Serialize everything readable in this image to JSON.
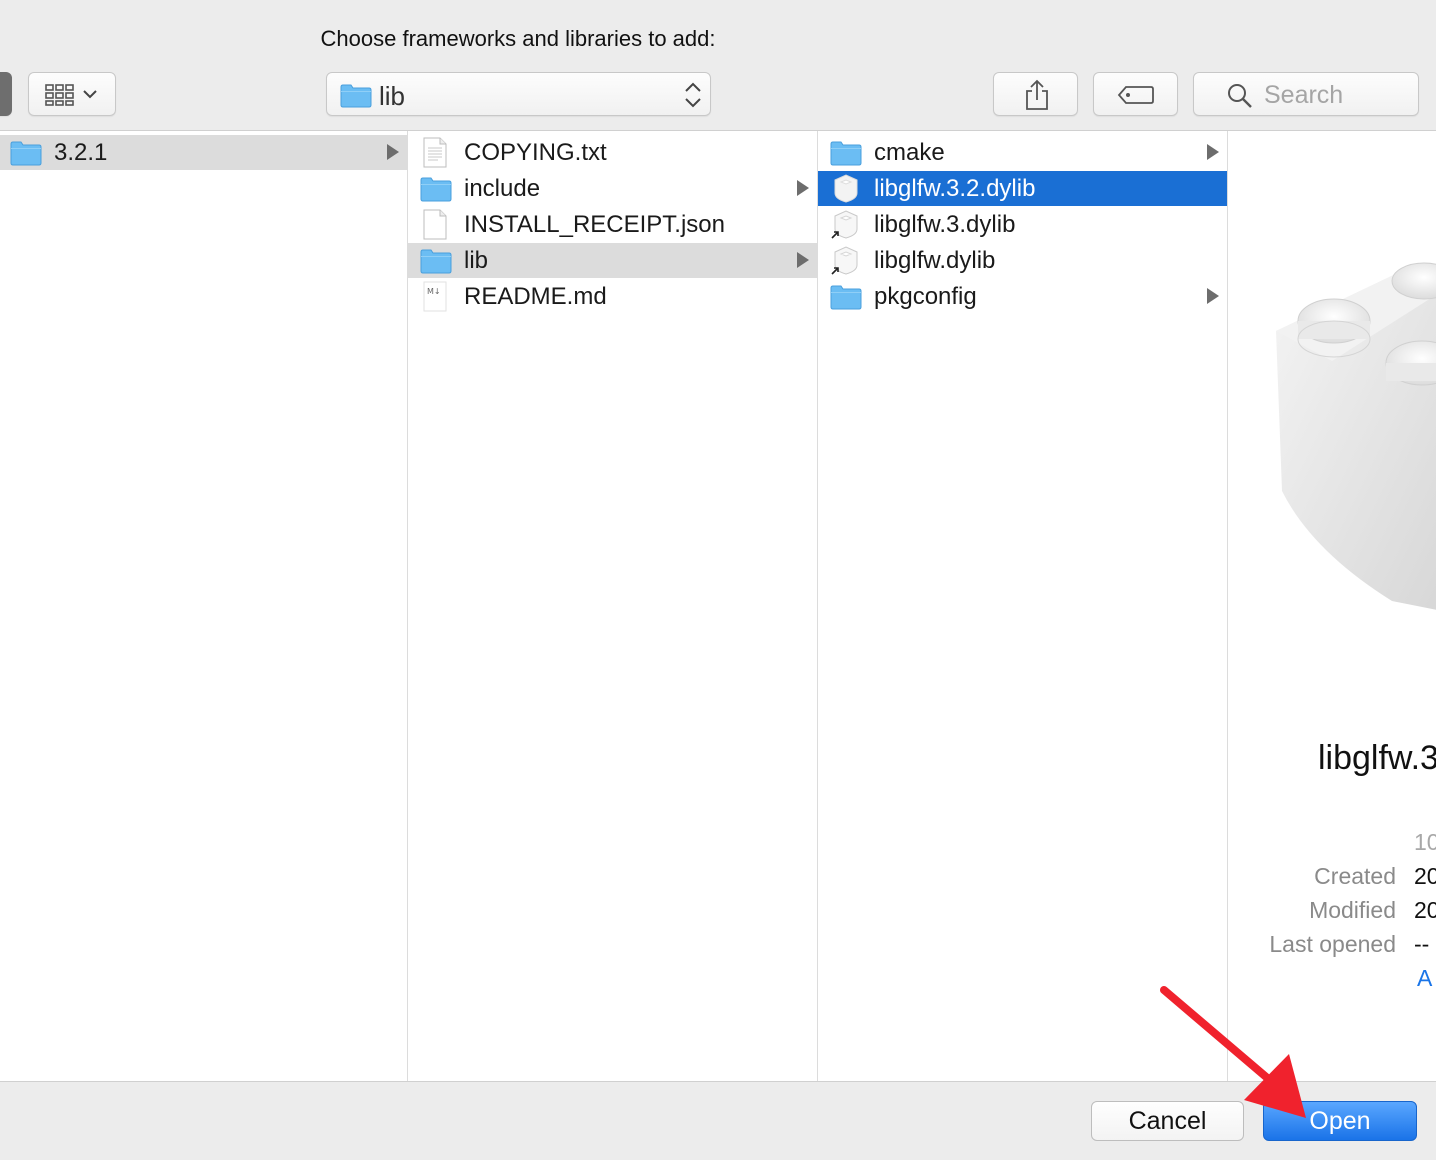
{
  "dialog": {
    "title": "Choose frameworks and libraries to add:"
  },
  "toolbar": {
    "view_icon": "grid-view-icon",
    "path_popup_value": "lib",
    "share_icon": "share-icon",
    "tag_icon": "tag-icon",
    "search_placeholder": "Search"
  },
  "columns": {
    "col1": [
      {
        "name": "3.2.1",
        "kind": "folder",
        "has_children": true,
        "selected": true
      }
    ],
    "col2": [
      {
        "name": "COPYING.txt",
        "kind": "text-file"
      },
      {
        "name": "include",
        "kind": "folder",
        "has_children": true
      },
      {
        "name": "INSTALL_RECEIPT.json",
        "kind": "file"
      },
      {
        "name": "lib",
        "kind": "folder",
        "has_children": true,
        "selected": true
      },
      {
        "name": "README.md",
        "kind": "markdown-file"
      }
    ],
    "col3": [
      {
        "name": "cmake",
        "kind": "folder",
        "has_children": true
      },
      {
        "name": "libglfw.3.2.dylib",
        "kind": "library-file",
        "selected": true
      },
      {
        "name": "libglfw.3.dylib",
        "kind": "library-alias"
      },
      {
        "name": "libglfw.dylib",
        "kind": "library-alias"
      },
      {
        "name": "pkgconfig",
        "kind": "folder",
        "has_children": true
      }
    ]
  },
  "preview": {
    "icon": "library-brick-icon",
    "name": "libglfw.3",
    "size_prefix": "10",
    "created_label": "Created",
    "created_value": "20",
    "modified_label": "Modified",
    "modified_value": "20",
    "last_opened_label": "Last opened",
    "last_opened_value": "--",
    "link_text": "A"
  },
  "buttons": {
    "cancel": "Cancel",
    "open": "Open"
  },
  "colors": {
    "selection_blue": "#1a6fd4",
    "folder_blue": "#69bdf3",
    "annotation_red": "#f0222d"
  }
}
